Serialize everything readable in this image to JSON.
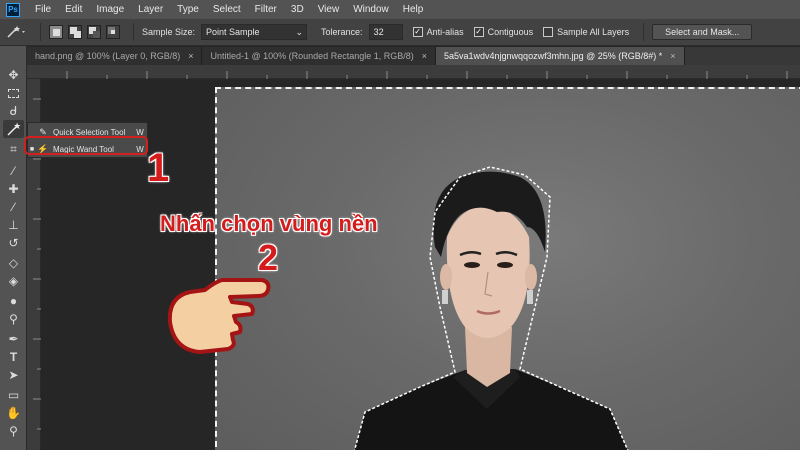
{
  "app": {
    "logo_text": "Ps"
  },
  "menubar": {
    "items": [
      "File",
      "Edit",
      "Image",
      "Layer",
      "Type",
      "Select",
      "Filter",
      "3D",
      "View",
      "Window",
      "Help"
    ]
  },
  "options": {
    "sample_size_label": "Sample Size:",
    "sample_size_value": "Point Sample",
    "tolerance_label": "Tolerance:",
    "tolerance_value": "32",
    "anti_alias_label": "Anti-alias",
    "contiguous_label": "Contiguous",
    "sample_all_layers_label": "Sample All Layers",
    "select_and_mask_label": "Select and Mask...",
    "anti_alias_checked": true,
    "contiguous_checked": true,
    "sample_all_layers_checked": false
  },
  "tabs": [
    {
      "label": "hand.png @ 100% (Layer 0, RGB/8)",
      "close": "×"
    },
    {
      "label": "Untitled-1 @ 100% (Rounded Rectangle 1, RGB/8)",
      "close": "×"
    },
    {
      "label": "5a5va1wdv4njgnwqqozwf3mhn.jpg @ 25% (RGB/8#) *",
      "close": "×"
    }
  ],
  "flyout": {
    "items": [
      {
        "label": "Quick Selection Tool",
        "shortcut": "W"
      },
      {
        "label": "Magic Wand Tool",
        "shortcut": "W",
        "bullet": "■"
      }
    ]
  },
  "annotations": {
    "step1": "1",
    "step2": "2",
    "instruction": "Nhấn chọn vùng nền"
  },
  "colors": {
    "annotation": "#d41c1c",
    "highlight": "#d21f1f",
    "menubar": "#535353",
    "canvas_bg": "#262626"
  },
  "tools": [
    "move-icon",
    "marquee-icon",
    "lasso-icon",
    "magic-wand-icon",
    "crop-icon",
    "eyedropper-icon",
    "healing-brush-icon",
    "brush-icon",
    "clone-stamp-icon",
    "history-brush-icon",
    "eraser-icon",
    "paint-bucket-icon",
    "blur-icon",
    "dodge-icon",
    "pen-icon",
    "type-icon",
    "path-selection-icon",
    "shape-icon",
    "hand-icon",
    "zoom-icon"
  ]
}
